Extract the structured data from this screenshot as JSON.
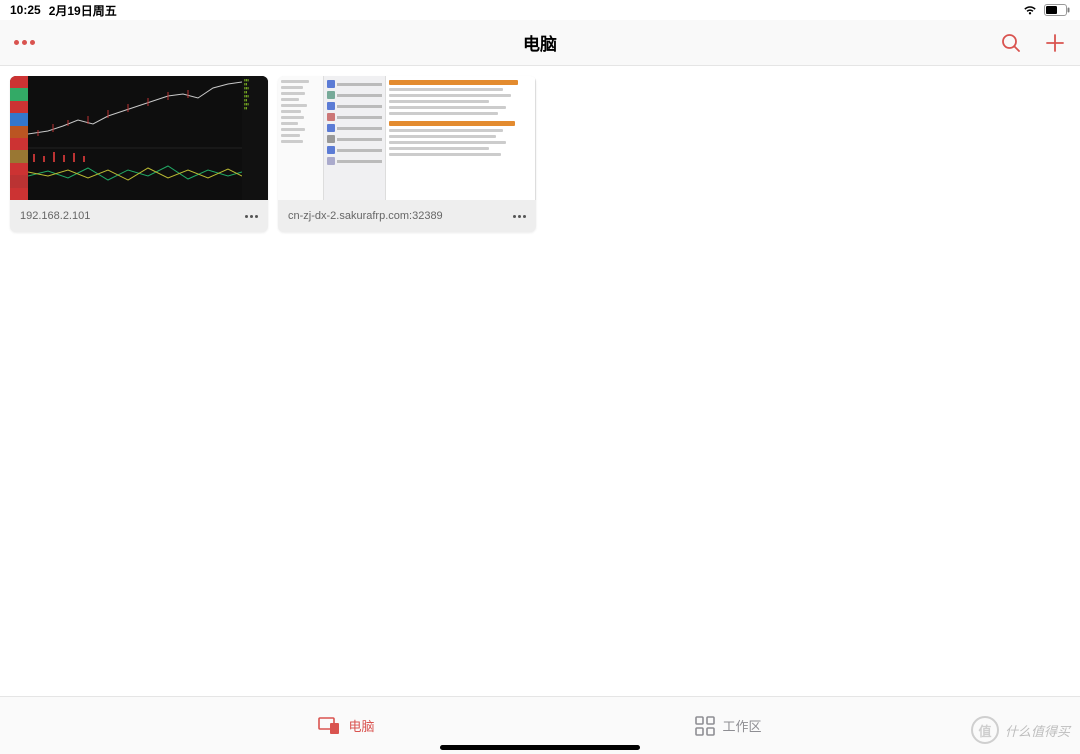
{
  "status": {
    "time": "10:25",
    "date": "2月19日周五"
  },
  "nav": {
    "title": "电脑"
  },
  "cards": [
    {
      "label": "192.168.2.101"
    },
    {
      "label": "cn-zj-dx-2.sakurafrp.com:32389"
    }
  ],
  "tabs": {
    "computers": "电脑",
    "workspaces": "工作区"
  },
  "watermark": {
    "badge": "值",
    "text": "什么值得买"
  }
}
